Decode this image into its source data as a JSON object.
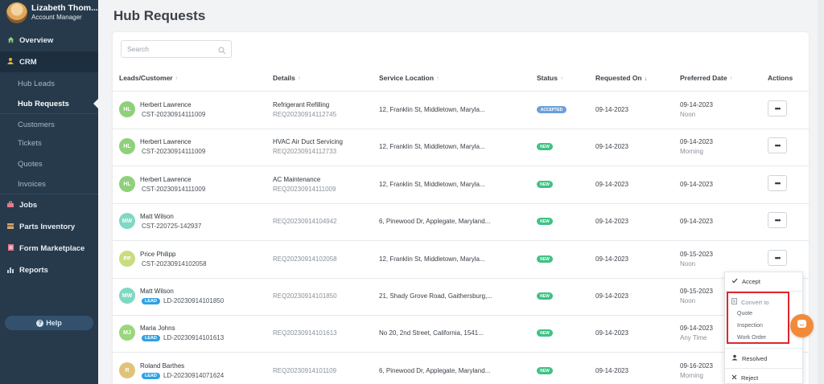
{
  "user": {
    "name": "Lizabeth Thom...",
    "role": "Account Manager"
  },
  "nav": {
    "overview": "Overview",
    "crm": "CRM",
    "crm_sub": [
      "Hub Leads",
      "Hub Requests",
      "Customers",
      "Tickets",
      "Quotes",
      "Invoices"
    ],
    "jobs": "Jobs",
    "parts": "Parts Inventory",
    "forms": "Form Marketplace",
    "reports": "Reports",
    "help": "Help"
  },
  "page": {
    "title": "Hub Requests"
  },
  "search": {
    "placeholder": "Search"
  },
  "table": {
    "headers": [
      "Leads/Customer",
      "Details",
      "Service Location",
      "Status",
      "Requested On",
      "Preferred Date",
      "Actions"
    ],
    "rows": [
      {
        "initials": "HL",
        "avatar_color": "#8fd07a",
        "name": "Herbert Lawrence",
        "lead": "",
        "id": "CST-20230914111009",
        "detail": "Refrigerant Refilling",
        "ref": "REQ20230914112745",
        "location": "12, Franklin St, Middletown, Maryla...",
        "status": "ACCEPTED",
        "requested": "09-14-2023",
        "preferred": "09-14-2023",
        "slot": "Noon"
      },
      {
        "initials": "HL",
        "avatar_color": "#8fd07a",
        "name": "Herbert Lawrence",
        "lead": "",
        "id": "CST-20230914111009",
        "detail": "HVAC Air Duct Servicing",
        "ref": "REQ20230914112733",
        "location": "12, Franklin St, Middletown, Maryla...",
        "status": "NEW",
        "requested": "09-14-2023",
        "preferred": "09-14-2023",
        "slot": "Morning"
      },
      {
        "initials": "HL",
        "avatar_color": "#8fd07a",
        "name": "Herbert Lawrence",
        "lead": "",
        "id": "CST-20230914111009",
        "detail": "AC Maintenance",
        "ref": "REQ20230914111009",
        "location": "12, Franklin St, Middletown, Maryla...",
        "status": "NEW",
        "requested": "09-14-2023",
        "preferred": "09-14-2023",
        "slot": ""
      },
      {
        "initials": "MW",
        "avatar_color": "#7fd8c2",
        "name": "Matt Wilson",
        "lead": "",
        "id": "CST-220725-142937",
        "detail": "",
        "ref": "REQ20230914104942",
        "location": "6, Pinewood Dr, Applegate, Maryland...",
        "status": "NEW",
        "requested": "09-14-2023",
        "preferred": "09-14-2023",
        "slot": ""
      },
      {
        "initials": "PP",
        "avatar_color": "#c9dc7e",
        "name": "Price Philipp",
        "lead": "",
        "id": "CST-20230914102058",
        "detail": "",
        "ref": "REQ20230914102058",
        "location": "12, Franklin St, Middletown, Maryla...",
        "status": "NEW",
        "requested": "09-14-2023",
        "preferred": "09-15-2023",
        "slot": "Noon"
      },
      {
        "initials": "MW",
        "avatar_color": "#7fd8c2",
        "name": "Matt Wilson",
        "lead": "LEAD",
        "id": "LD-20230914101850",
        "detail": "",
        "ref": "REQ20230914101850",
        "location": "21, Shady Grove Road, Gaithersburg,...",
        "status": "NEW",
        "requested": "09-14-2023",
        "preferred": "09-15-2023",
        "slot": "Noon"
      },
      {
        "initials": "MJ",
        "avatar_color": "#9ad67a",
        "name": "Maria Johns",
        "lead": "LEAD",
        "id": "LD-20230914101613",
        "detail": "",
        "ref": "REQ20230914101613",
        "location": "No 20, 2nd Street, California, 1541...",
        "status": "NEW",
        "requested": "09-14-2023",
        "preferred": "09-14-2023",
        "slot": "Any Time"
      },
      {
        "initials": "R",
        "avatar_color": "#e0c27a",
        "name": "Roland Barthes",
        "lead": "LEAD",
        "id": "LD-20230914071624",
        "detail": "",
        "ref": "REQ20230914101109",
        "location": "6, Pinewood Dr, Applegate, Maryland...",
        "status": "NEW",
        "requested": "09-14-2023",
        "preferred": "09-16-2023",
        "slot": "Morning"
      }
    ],
    "action_label": "•••"
  },
  "dropdown": {
    "accept": "Accept",
    "convert_to": "Convert to",
    "quote": "Quote",
    "inspection": "Inspection",
    "work_order": "Work Order",
    "resolved": "Resolved",
    "reject": "Reject"
  }
}
